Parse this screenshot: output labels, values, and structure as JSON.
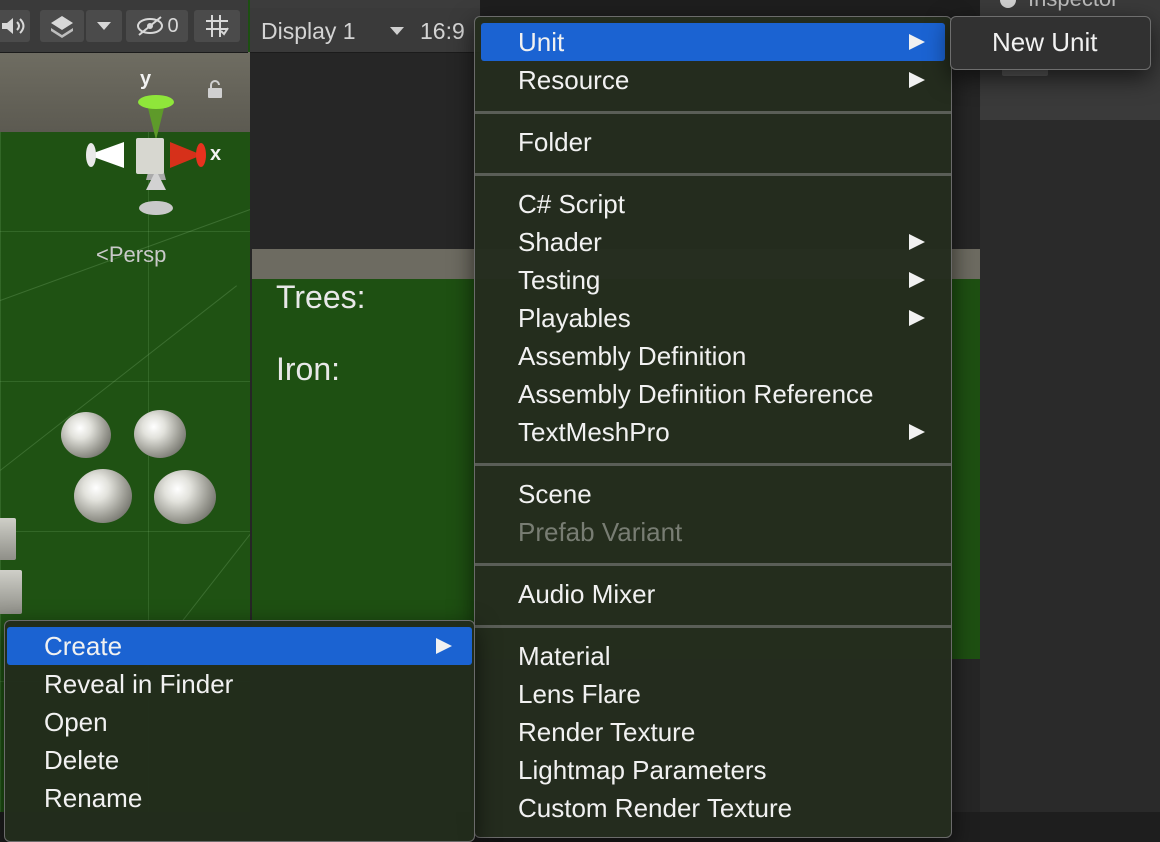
{
  "scene_toolbar": {
    "audio_icon": "speaker-icon",
    "gizmo_icon": "layers-icon",
    "visibility_count": "0",
    "grid_icon": "grid-icon"
  },
  "scene": {
    "axis_y": "y",
    "axis_x": "x",
    "persp_label": "Persp"
  },
  "game_toolbar": {
    "display": "Display 1",
    "aspect": "16:9"
  },
  "game_view": {
    "trees_label": "Trees:",
    "iron_label": "Iron:"
  },
  "inspector": {
    "title": "Inspector"
  },
  "create_menu": {
    "items": [
      {
        "label": "Unit",
        "submenu": true,
        "highlighted": true
      },
      {
        "label": "Resource",
        "submenu": true
      },
      {
        "label": "Folder"
      },
      {
        "label": "C# Script"
      },
      {
        "label": "Shader",
        "submenu": true
      },
      {
        "label": "Testing",
        "submenu": true
      },
      {
        "label": "Playables",
        "submenu": true
      },
      {
        "label": "Assembly Definition"
      },
      {
        "label": "Assembly Definition Reference"
      },
      {
        "label": "TextMeshPro",
        "submenu": true
      },
      {
        "label": "Scene"
      },
      {
        "label": "Prefab Variant",
        "disabled": true
      },
      {
        "label": "Audio Mixer"
      },
      {
        "label": "Material"
      },
      {
        "label": "Lens Flare"
      },
      {
        "label": "Render Texture"
      },
      {
        "label": "Lightmap Parameters"
      },
      {
        "label": "Custom Render Texture"
      }
    ]
  },
  "unit_submenu": {
    "items": [
      {
        "label": "New Unit"
      }
    ]
  },
  "context_menu": {
    "items": [
      {
        "label": "Create",
        "submenu": true,
        "highlighted": true
      },
      {
        "label": "Reveal in Finder"
      },
      {
        "label": "Open"
      },
      {
        "label": "Delete"
      },
      {
        "label": "Rename"
      }
    ]
  },
  "colors": {
    "highlight": "#1b63d2",
    "menu_bg": "#242c1e",
    "scene_ground": "#1f5213",
    "axis_y": "#8fe63a",
    "axis_x": "#e8321e"
  }
}
